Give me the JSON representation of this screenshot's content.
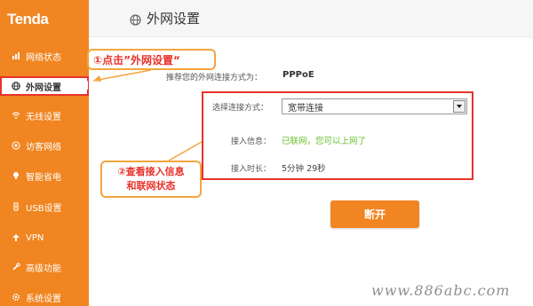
{
  "app": {
    "logo": "Tenda"
  },
  "sidebar": {
    "items": [
      {
        "label": "网络状态",
        "icon": "network-status-icon"
      },
      {
        "label": "外网设置",
        "icon": "globe-icon",
        "active": true
      },
      {
        "label": "无线设置",
        "icon": "wifi-icon"
      },
      {
        "label": "访客网络",
        "icon": "guest-icon"
      },
      {
        "label": "智能省电",
        "icon": "bulb-icon"
      },
      {
        "label": "USB设置",
        "icon": "usb-icon"
      },
      {
        "label": "VPN",
        "icon": "vpn-icon"
      },
      {
        "label": "高级功能",
        "icon": "wrench-icon"
      },
      {
        "label": "系统设置",
        "icon": "gear-icon"
      }
    ]
  },
  "header": {
    "title": "外网设置"
  },
  "callouts": {
    "step1": "①点击”外网设置“",
    "step2_line1": "②查看接入信息",
    "step2_line2": "和联网状态"
  },
  "main": {
    "recommended_label": "推荐您的外网连接方式为：",
    "recommended_value": "PPPoE",
    "connection_label": "选择连接方式：",
    "connection_value": "宽带连接",
    "access_label": "接入信息：",
    "access_value": "已联网，您可以上网了",
    "duration_label": "接入时长：",
    "duration_value": "5分钟 29秒",
    "disconnect_button": "断开"
  },
  "watermark": "www.886abc.com",
  "colors": {
    "brand_orange": "#f08521",
    "highlight_red": "#e8322a",
    "status_green": "#6abf2c"
  }
}
